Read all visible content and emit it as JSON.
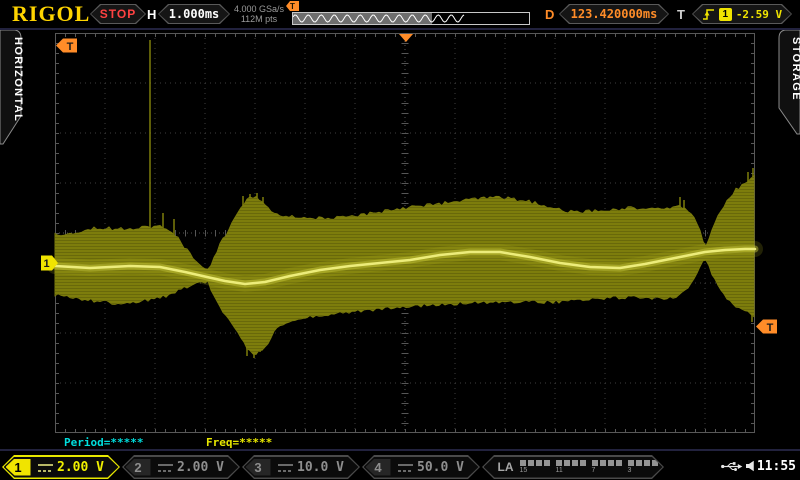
{
  "topbar": {
    "logo": "RIGOL",
    "run_state": "STOP",
    "h_label": "H",
    "h_scale": "1.000ms",
    "sample_rate": "4.000 GSa/s",
    "memory_depth": "112M pts",
    "mem_trigger_flag": "T",
    "d_label": "D",
    "delay_offset": "123.420000ms",
    "t_label": "T",
    "trigger_channel": "1",
    "trigger_level": "-2.59 V"
  },
  "tabs": {
    "left": "HORIZONTAL",
    "right": "STORAGE"
  },
  "markers": {
    "trigger_time_flag": "T",
    "trigger_level_flag": "T",
    "channel_marker": "1"
  },
  "measurements": {
    "period": "Period=*****",
    "freq": "Freq=*****"
  },
  "channels": [
    {
      "num": "1",
      "scale": "2.00 V",
      "active": true
    },
    {
      "num": "2",
      "scale": "2.00 V",
      "active": false
    },
    {
      "num": "3",
      "scale": "10.0 V",
      "active": false
    },
    {
      "num": "4",
      "scale": "50.0 V",
      "active": false
    }
  ],
  "logic_analyzer": {
    "label": "LA",
    "group_labels": [
      "15",
      "11",
      "7",
      "3"
    ],
    "channels_per_group": 4
  },
  "statusbar": {
    "time": "11:55"
  },
  "colors": {
    "accent_yellow": "#f0e400",
    "accent_orange": "#ff8c28",
    "stop_red": "#ff4242",
    "cyan": "#00dede",
    "grid": "#3e3e3e",
    "grid_center": "#565656",
    "grid_border": "#585858",
    "waveform": "#7d7d0c",
    "waveform_core": "#f0f080"
  },
  "waveform": {
    "top": [
      [
        55,
        237
      ],
      [
        75,
        234
      ],
      [
        95,
        230
      ],
      [
        115,
        231
      ],
      [
        135,
        230
      ],
      [
        148,
        229
      ],
      [
        158,
        228
      ],
      [
        168,
        233
      ],
      [
        178,
        241
      ],
      [
        188,
        253
      ],
      [
        198,
        265
      ],
      [
        204,
        271
      ],
      [
        208,
        273
      ],
      [
        213,
        262
      ],
      [
        220,
        246
      ],
      [
        228,
        233
      ],
      [
        236,
        218
      ],
      [
        244,
        206
      ],
      [
        252,
        198
      ],
      [
        260,
        202
      ],
      [
        268,
        210
      ],
      [
        276,
        217
      ],
      [
        290,
        219
      ],
      [
        310,
        220
      ],
      [
        330,
        221
      ],
      [
        350,
        219
      ],
      [
        370,
        216
      ],
      [
        390,
        212
      ],
      [
        410,
        209
      ],
      [
        430,
        207
      ],
      [
        450,
        205
      ],
      [
        470,
        202
      ],
      [
        490,
        200
      ],
      [
        510,
        201
      ],
      [
        530,
        204
      ],
      [
        550,
        210
      ],
      [
        570,
        214
      ],
      [
        590,
        214
      ],
      [
        610,
        212
      ],
      [
        630,
        210
      ],
      [
        650,
        211
      ],
      [
        665,
        212
      ],
      [
        678,
        207
      ],
      [
        686,
        211
      ],
      [
        692,
        217
      ],
      [
        698,
        228
      ],
      [
        702,
        240
      ],
      [
        705,
        248
      ],
      [
        708,
        244
      ],
      [
        712,
        231
      ],
      [
        718,
        219
      ],
      [
        726,
        204
      ],
      [
        736,
        192
      ],
      [
        746,
        184
      ],
      [
        755,
        179
      ]
    ],
    "bottom": [
      [
        55,
        293
      ],
      [
        75,
        296
      ],
      [
        95,
        299
      ],
      [
        115,
        301
      ],
      [
        135,
        300
      ],
      [
        148,
        298
      ],
      [
        158,
        296
      ],
      [
        168,
        294
      ],
      [
        178,
        289
      ],
      [
        188,
        284
      ],
      [
        198,
        281
      ],
      [
        204,
        280
      ],
      [
        208,
        280
      ],
      [
        213,
        292
      ],
      [
        220,
        305
      ],
      [
        228,
        317
      ],
      [
        236,
        328
      ],
      [
        244,
        341
      ],
      [
        252,
        352
      ],
      [
        260,
        350
      ],
      [
        268,
        342
      ],
      [
        276,
        327
      ],
      [
        290,
        318
      ],
      [
        310,
        315
      ],
      [
        330,
        312
      ],
      [
        350,
        310
      ],
      [
        370,
        308
      ],
      [
        390,
        306
      ],
      [
        410,
        304
      ],
      [
        430,
        303
      ],
      [
        450,
        302
      ],
      [
        470,
        301
      ],
      [
        490,
        300
      ],
      [
        510,
        300
      ],
      [
        530,
        300
      ],
      [
        550,
        300
      ],
      [
        570,
        299
      ],
      [
        590,
        297
      ],
      [
        610,
        296
      ],
      [
        630,
        295
      ],
      [
        650,
        296
      ],
      [
        665,
        296
      ],
      [
        678,
        294
      ],
      [
        686,
        288
      ],
      [
        692,
        280
      ],
      [
        698,
        269
      ],
      [
        702,
        259
      ],
      [
        705,
        255
      ],
      [
        708,
        261
      ],
      [
        712,
        272
      ],
      [
        718,
        283
      ],
      [
        726,
        295
      ],
      [
        736,
        304
      ],
      [
        746,
        310
      ],
      [
        755,
        314
      ]
    ],
    "core": [
      [
        55,
        266
      ],
      [
        90,
        268
      ],
      [
        130,
        266
      ],
      [
        160,
        267
      ],
      [
        185,
        272
      ],
      [
        207,
        277
      ],
      [
        225,
        281
      ],
      [
        245,
        284
      ],
      [
        265,
        282
      ],
      [
        290,
        276
      ],
      [
        320,
        270
      ],
      [
        350,
        266
      ],
      [
        380,
        263
      ],
      [
        410,
        260
      ],
      [
        440,
        255
      ],
      [
        470,
        252
      ],
      [
        500,
        252
      ],
      [
        530,
        257
      ],
      [
        560,
        263
      ],
      [
        590,
        267
      ],
      [
        620,
        268
      ],
      [
        645,
        264
      ],
      [
        665,
        260
      ],
      [
        685,
        256
      ],
      [
        705,
        252
      ],
      [
        725,
        250
      ],
      [
        745,
        249
      ],
      [
        755,
        249
      ]
    ],
    "spikes": [
      [
        150,
        40,
        230
      ],
      [
        163,
        213,
        230
      ],
      [
        174,
        219,
        236
      ],
      [
        243,
        196,
        210
      ],
      [
        250,
        194,
        214
      ],
      [
        257,
        193,
        206
      ],
      [
        263,
        197,
        215
      ],
      [
        247,
        340,
        356
      ],
      [
        254,
        344,
        358
      ],
      [
        260,
        338,
        352
      ],
      [
        680,
        197,
        212
      ],
      [
        684,
        200,
        214
      ],
      [
        748,
        172,
        186
      ],
      [
        753,
        168,
        182
      ],
      [
        752,
        314,
        322
      ]
    ]
  }
}
